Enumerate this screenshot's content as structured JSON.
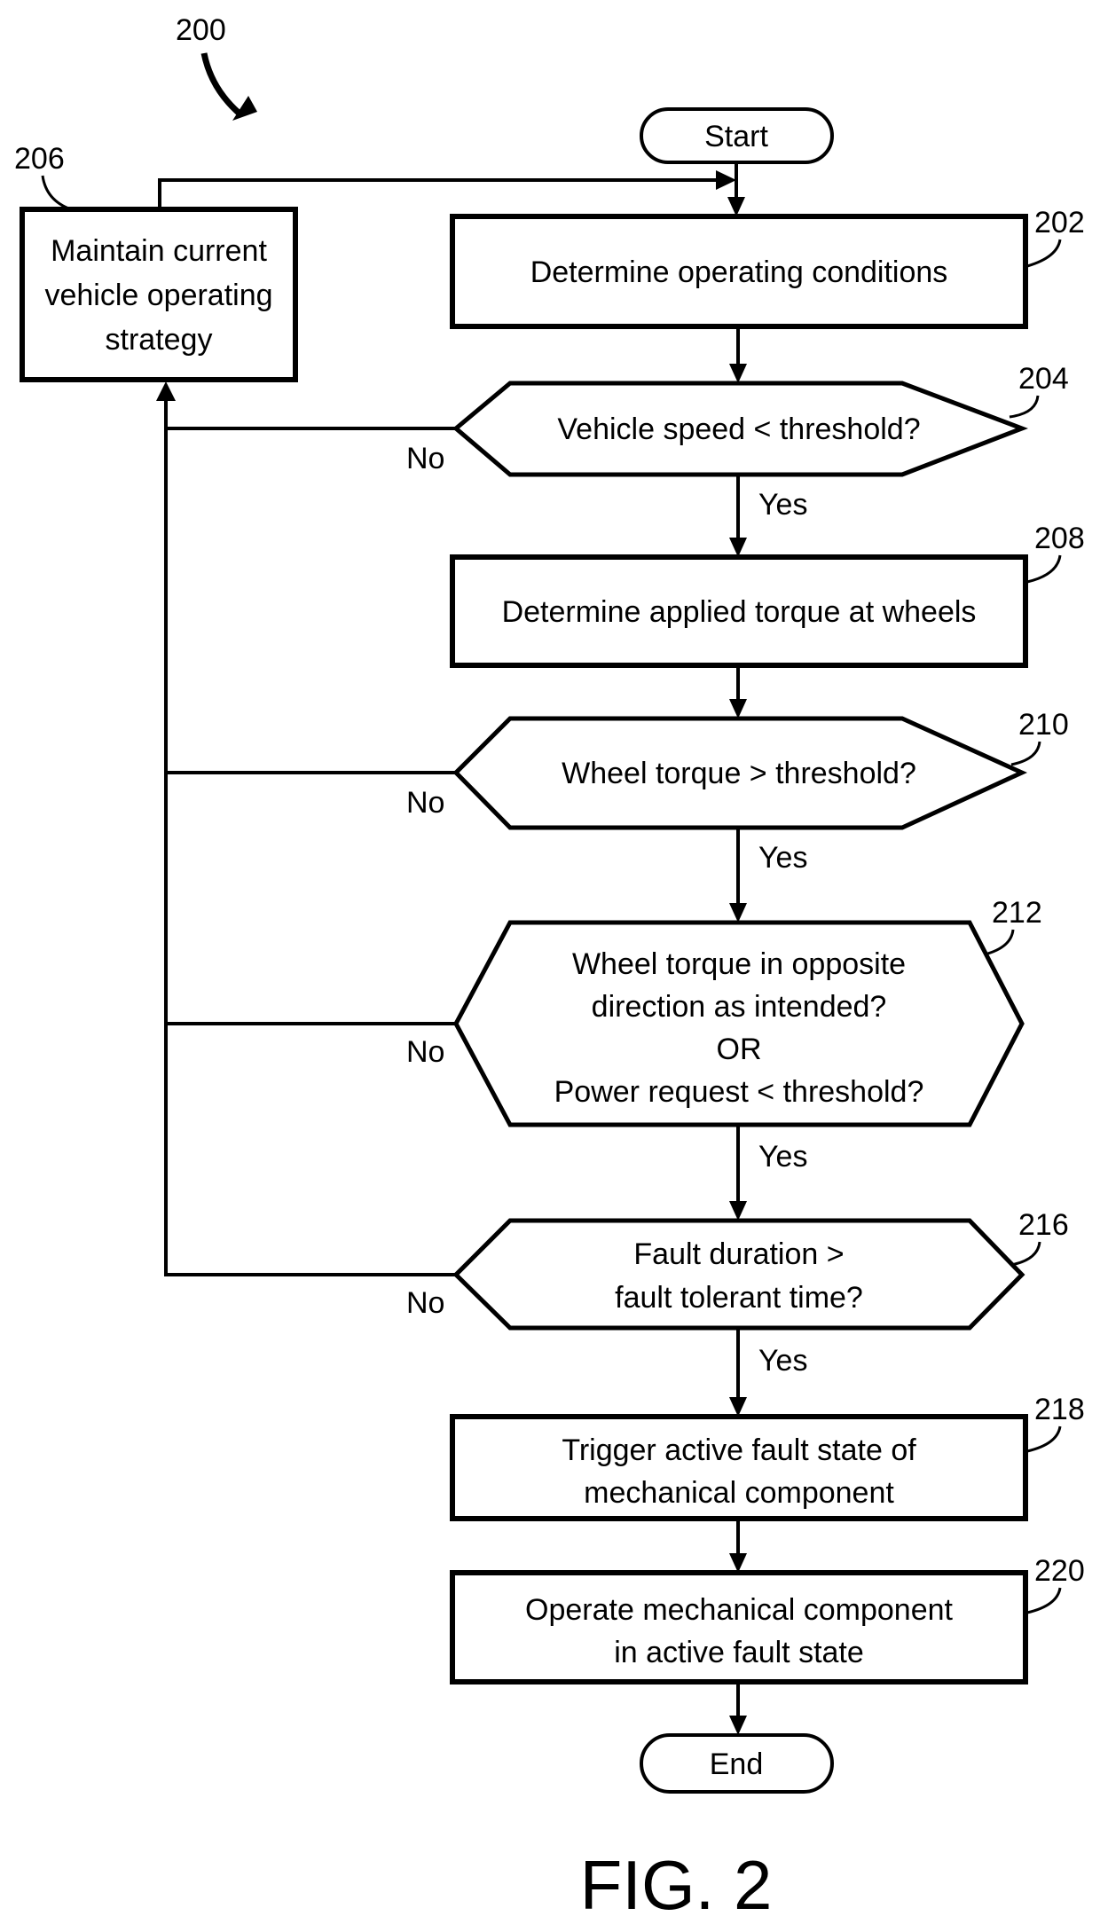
{
  "figure": {
    "reference": "200",
    "caption": "FIG. 2"
  },
  "terminals": {
    "start": "Start",
    "end": "End"
  },
  "steps": [
    {
      "id": "202",
      "type": "process",
      "lines": [
        "Determine operating conditions"
      ]
    },
    {
      "id": "204",
      "type": "decision",
      "lines": [
        "Vehicle speed < threshold?"
      ],
      "yes": "Yes",
      "no": "No"
    },
    {
      "id": "206",
      "type": "process",
      "lines": [
        "Maintain current",
        "vehicle operating",
        "strategy"
      ]
    },
    {
      "id": "208",
      "type": "process",
      "lines": [
        "Determine applied torque at wheels"
      ]
    },
    {
      "id": "210",
      "type": "decision",
      "lines": [
        "Wheel torque > threshold?"
      ],
      "yes": "Yes",
      "no": "No"
    },
    {
      "id": "212",
      "type": "decision",
      "lines": [
        "Wheel torque in opposite",
        "direction as intended?",
        "OR",
        "Power request < threshold?"
      ],
      "yes": "Yes",
      "no": "No"
    },
    {
      "id": "216",
      "type": "decision",
      "lines": [
        "Fault duration >",
        "fault tolerant time?"
      ],
      "yes": "Yes",
      "no": "No"
    },
    {
      "id": "218",
      "type": "process",
      "lines": [
        "Trigger active fault state of",
        "mechanical component"
      ]
    },
    {
      "id": "220",
      "type": "process",
      "lines": [
        "Operate mechanical component",
        "in active fault state"
      ]
    }
  ],
  "edges": [
    {
      "from": "start",
      "to": "202"
    },
    {
      "from": "202",
      "to": "204"
    },
    {
      "from": "204",
      "to": "208",
      "label": "Yes"
    },
    {
      "from": "204",
      "to": "206",
      "label": "No"
    },
    {
      "from": "208",
      "to": "210"
    },
    {
      "from": "210",
      "to": "212",
      "label": "Yes"
    },
    {
      "from": "210",
      "to": "206",
      "label": "No"
    },
    {
      "from": "212",
      "to": "216",
      "label": "Yes"
    },
    {
      "from": "212",
      "to": "206",
      "label": "No"
    },
    {
      "from": "216",
      "to": "218",
      "label": "Yes"
    },
    {
      "from": "216",
      "to": "206",
      "label": "No"
    },
    {
      "from": "218",
      "to": "220"
    },
    {
      "from": "220",
      "to": "end"
    },
    {
      "from": "206",
      "to": "202"
    }
  ]
}
